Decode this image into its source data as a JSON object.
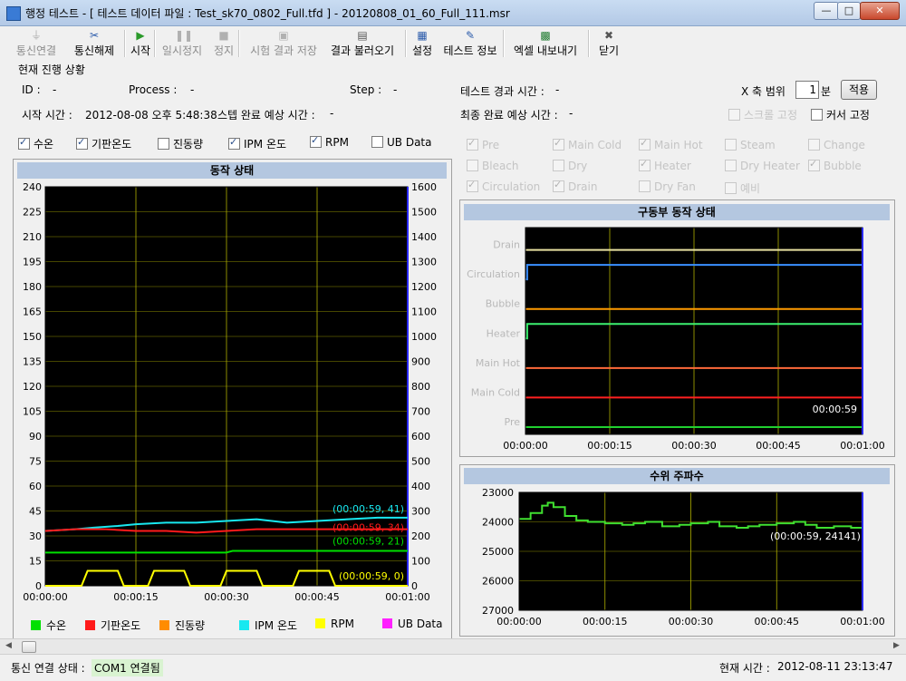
{
  "window": {
    "title": "행정 테스트 - [ 테스트 데이터 파일 : Test_sk70_0802_Full.tfd ] - 20120808_01_60_Full_111.msr",
    "minimize": "—",
    "maximize": "□",
    "close": "✕"
  },
  "toolbar": {
    "items": [
      {
        "label": "통신연결",
        "icon": "plug-icon",
        "disabled": true
      },
      {
        "label": "통신해제",
        "icon": "unplug-icon",
        "disabled": false
      },
      {
        "label": "시작",
        "icon": "play-icon",
        "disabled": false
      },
      {
        "label": "일시정지",
        "icon": "pause-icon",
        "disabled": true
      },
      {
        "label": "정지",
        "icon": "stop-icon",
        "disabled": true
      },
      {
        "label": "시험 결과 저장",
        "icon": "save-icon",
        "disabled": true
      },
      {
        "label": "결과 불러오기",
        "icon": "open-file-icon",
        "disabled": false
      },
      {
        "label": "설정",
        "icon": "settings-chart-icon",
        "disabled": false
      },
      {
        "label": "테스트 정보",
        "icon": "edit-icon",
        "disabled": false
      },
      {
        "label": "엑셀 내보내기",
        "icon": "excel-icon",
        "disabled": false
      },
      {
        "label": "닫기",
        "icon": "close-x-icon",
        "disabled": false
      }
    ]
  },
  "status_group": {
    "title": "현재 진행 상황",
    "id_label": "ID :",
    "id_value": "-",
    "process_label": "Process :",
    "process_value": "-",
    "step_label": "Step :",
    "step_value": "-",
    "elapsed_label": "테스트 경과 시간 :",
    "elapsed_value": "-",
    "xrange_label": "X 축 범위",
    "xrange_value": "1",
    "xrange_unit": "분",
    "apply_button": "적용",
    "start_label": "시작 시간 :",
    "start_value": "2012-08-08 오후 5:48:38",
    "step_eta_label": "스텝 완료 예상 시간 :",
    "step_eta_value": "-",
    "final_eta_label": "최종 완료 예상 시간 :",
    "final_eta_value": "-",
    "scroll_lock": "스크롤 고정",
    "cursor_lock": "커서 고정"
  },
  "series_checks": [
    {
      "label": "수온",
      "checked": true
    },
    {
      "label": "기판온도",
      "checked": true
    },
    {
      "label": "진동량",
      "checked": false
    },
    {
      "label": "IPM 온도",
      "checked": true
    },
    {
      "label": "RPM",
      "checked": true
    },
    {
      "label": "UB Data",
      "checked": false
    }
  ],
  "actuator_checks": [
    {
      "label": "Pre",
      "checked": true
    },
    {
      "label": "Main Cold",
      "checked": true
    },
    {
      "label": "Main Hot",
      "checked": true
    },
    {
      "label": "Steam",
      "checked": false
    },
    {
      "label": "Change",
      "checked": false
    },
    {
      "label": "Bleach",
      "checked": false
    },
    {
      "label": "Dry",
      "checked": false
    },
    {
      "label": "Heater",
      "checked": true
    },
    {
      "label": "Dry Heater",
      "checked": false
    },
    {
      "label": "Bubble",
      "checked": true
    },
    {
      "label": "Circulation",
      "checked": true
    },
    {
      "label": "Drain",
      "checked": true
    },
    {
      "label": "Dry Fan",
      "checked": false
    },
    {
      "label": "예비",
      "checked": false
    }
  ],
  "colors": {
    "water_temp": "#00e000",
    "board_temp": "#ff1a1a",
    "vibration": "#ff8c00",
    "ipm_temp": "#18e8f0",
    "rpm": "#ffff00",
    "ub_data": "#ff20ff",
    "plot_bg": "#000000",
    "grid": "#b0b000",
    "panel_header": "#b4c7e0"
  },
  "chart_data": [
    {
      "type": "line",
      "title": "동작 상태",
      "x_ticks": [
        "00:00:00",
        "00:00:15",
        "00:00:30",
        "00:00:45",
        "00:01:00"
      ],
      "xlim": [
        0,
        60
      ],
      "ylim_left": [
        0,
        240
      ],
      "ylim_right": [
        0,
        1600
      ],
      "y_ticks_left": [
        "0",
        "15",
        "30",
        "45",
        "60",
        "75",
        "90",
        "105",
        "120",
        "135",
        "150",
        "165",
        "180",
        "195",
        "210",
        "225",
        "240"
      ],
      "y_ticks_right": [
        "0",
        "100",
        "200",
        "300",
        "400",
        "500",
        "600",
        "700",
        "800",
        "900",
        "1000",
        "1100",
        "1200",
        "1300",
        "1400",
        "1500",
        "1600"
      ],
      "series": [
        {
          "name": "IPM 온도",
          "color": "#18e8f0",
          "axis": "left",
          "x": [
            0,
            5,
            8,
            12,
            15,
            20,
            25,
            30,
            35,
            40,
            45,
            50,
            55,
            60
          ],
          "y": [
            33,
            34,
            35,
            36,
            37,
            38,
            38,
            39,
            40,
            38,
            39,
            40,
            41,
            41
          ]
        },
        {
          "name": "기판온도",
          "color": "#ff1a1a",
          "axis": "left",
          "x": [
            0,
            5,
            10,
            15,
            20,
            25,
            30,
            35,
            40,
            45,
            50,
            55,
            60
          ],
          "y": [
            33,
            34,
            34,
            33,
            33,
            32,
            33,
            34,
            34,
            34,
            34,
            34,
            34
          ]
        },
        {
          "name": "수온",
          "color": "#00e000",
          "axis": "left",
          "x": [
            0,
            30,
            31,
            60
          ],
          "y": [
            20,
            20,
            21,
            21
          ]
        },
        {
          "name": "RPM",
          "color": "#ffff00",
          "axis": "right",
          "x": [
            0,
            6,
            7,
            12,
            13,
            17,
            18,
            23,
            24,
            29,
            30,
            35,
            36,
            41,
            42,
            47,
            48,
            60
          ],
          "y": [
            0,
            0,
            60,
            60,
            0,
            0,
            60,
            60,
            0,
            0,
            60,
            60,
            0,
            0,
            60,
            60,
            0,
            0
          ]
        }
      ],
      "annotations": [
        {
          "text": "(00:00:59, 41)",
          "color": "#18e8f0"
        },
        {
          "text": "(00:00:59, 34)",
          "color": "#ff1a1a"
        },
        {
          "text": "(00:00:59, 21)",
          "color": "#00e000"
        },
        {
          "text": "(00:00:59, 0)",
          "color": "#ffff00"
        }
      ],
      "legend": [
        {
          "name": "수온",
          "color": "#00e000"
        },
        {
          "name": "기판온도",
          "color": "#ff1a1a"
        },
        {
          "name": "진동량",
          "color": "#ff8c00"
        },
        {
          "name": "IPM 온도",
          "color": "#18e8f0"
        },
        {
          "name": "RPM",
          "color": "#ffff00"
        },
        {
          "name": "UB Data",
          "color": "#ff20ff"
        }
      ]
    },
    {
      "type": "line",
      "title": "구동부 동작 상태",
      "x_ticks": [
        "00:00:00",
        "00:00:15",
        "00:00:30",
        "00:00:45",
        "00:01:00"
      ],
      "xlim": [
        0,
        60
      ],
      "categories": [
        "Drain",
        "Circulation",
        "Bubble",
        "Heater",
        "Main Hot",
        "Main Cold",
        "Pre"
      ],
      "series": [
        {
          "name": "Drain",
          "color": "#e8e0a0",
          "x": [
            0,
            60
          ],
          "y": [
            "off",
            "off"
          ]
        },
        {
          "name": "Circulation",
          "color": "#3a8fff",
          "x": [
            0,
            0.3,
            60
          ],
          "y": [
            "off",
            "on",
            "on"
          ]
        },
        {
          "name": "Bubble",
          "color": "#ff9a00",
          "x": [
            0,
            60
          ],
          "y": [
            "off",
            "off"
          ]
        },
        {
          "name": "Heater",
          "color": "#3cf070",
          "x": [
            0,
            0.3,
            60
          ],
          "y": [
            "off",
            "on",
            "on"
          ]
        },
        {
          "name": "Main Hot",
          "color": "#ff6a3a",
          "x": [
            0,
            60
          ],
          "y": [
            "off",
            "off"
          ]
        },
        {
          "name": "Main Cold",
          "color": "#ff2020",
          "x": [
            0,
            60
          ],
          "y": [
            "off",
            "off"
          ]
        },
        {
          "name": "Pre",
          "color": "#20d030",
          "x": [
            0,
            60
          ],
          "y": [
            "off",
            "off"
          ]
        }
      ],
      "annotation": "00:00:59"
    },
    {
      "type": "line",
      "title": "수위 주파수",
      "x_ticks": [
        "00:00:00",
        "00:00:15",
        "00:00:30",
        "00:00:45",
        "00:01:00"
      ],
      "xlim": [
        0,
        60
      ],
      "ylim": [
        23000,
        27000
      ],
      "y_inverted": true,
      "y_ticks": [
        "23000",
        "24000",
        "25000",
        "26000",
        "27000"
      ],
      "series": [
        {
          "name": "수위 주파수",
          "color": "#40e030",
          "x": [
            0,
            2,
            4,
            5,
            6,
            8,
            10,
            12,
            15,
            18,
            20,
            22,
            25,
            28,
            30,
            33,
            35,
            38,
            40,
            42,
            45,
            48,
            50,
            52,
            55,
            58,
            60
          ],
          "y": [
            23900,
            23700,
            23450,
            23350,
            23500,
            23800,
            23950,
            24000,
            24050,
            24100,
            24050,
            24000,
            24150,
            24100,
            24050,
            24000,
            24150,
            24200,
            24150,
            24100,
            24050,
            24000,
            24100,
            24200,
            24150,
            24200,
            24141
          ]
        }
      ],
      "annotation": "(00:00:59, 24141)"
    }
  ],
  "statusbar": {
    "comm_label": "통신 연결 상태 :",
    "comm_value": "COM1 연결됨",
    "time_label": "현재 시간 :",
    "time_value": "2012-08-11 23:13:47"
  }
}
